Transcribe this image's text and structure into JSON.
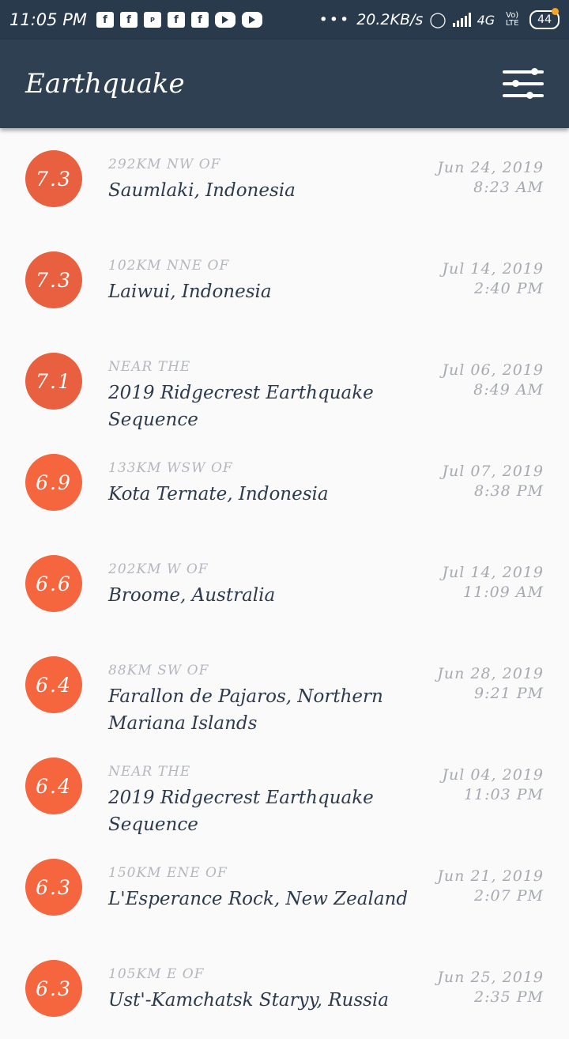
{
  "status_bar": {
    "time": "11:05 PM",
    "speed": "20.2KB/s",
    "network": "4G",
    "volte": "Vo) LTE",
    "battery": "44",
    "dots": "•••"
  },
  "app_bar": {
    "title": "Earthquake",
    "filter_icon": "filter-sliders-icon"
  },
  "colors": {
    "status_bar_bg": "#283a4c",
    "app_bar_bg": "#2e4052",
    "mag_high": "#e8603f",
    "mag_mid": "#f5663e",
    "text_primary": "#2d3a4c",
    "text_secondary": "#b4b7bf"
  },
  "quakes": [
    {
      "mag": "7.3",
      "offset": "292KM NW OF",
      "place": "Saumlaki, Indonesia",
      "date": "Jun 24, 2019",
      "time": "8:23 AM"
    },
    {
      "mag": "7.3",
      "offset": "102KM NNE OF",
      "place": "Laiwui, Indonesia",
      "date": "Jul 14, 2019",
      "time": "2:40 PM"
    },
    {
      "mag": "7.1",
      "offset": "NEAR THE",
      "place": "2019 Ridgecrest Earthquake Sequence",
      "date": "Jul 06, 2019",
      "time": "8:49 AM"
    },
    {
      "mag": "6.9",
      "offset": "133KM WSW OF",
      "place": "Kota Ternate, Indonesia",
      "date": "Jul 07, 2019",
      "time": "8:38 PM"
    },
    {
      "mag": "6.6",
      "offset": "202KM W OF",
      "place": "Broome, Australia",
      "date": "Jul 14, 2019",
      "time": "11:09 AM"
    },
    {
      "mag": "6.4",
      "offset": "88KM SW OF",
      "place": "Farallon de Pajaros, Northern Mariana Islands",
      "date": "Jun 28, 2019",
      "time": "9:21 PM"
    },
    {
      "mag": "6.4",
      "offset": "NEAR THE",
      "place": "2019 Ridgecrest Earthquake Sequence",
      "date": "Jul 04, 2019",
      "time": "11:03 PM"
    },
    {
      "mag": "6.3",
      "offset": "150KM ENE OF",
      "place": "L'Esperance Rock, New Zealand",
      "date": "Jun 21, 2019",
      "time": "2:07 PM"
    },
    {
      "mag": "6.3",
      "offset": "105KM E OF",
      "place": "Ust'-Kamchatsk Staryy, Russia",
      "date": "Jun 25, 2019",
      "time": "2:35 PM"
    }
  ]
}
